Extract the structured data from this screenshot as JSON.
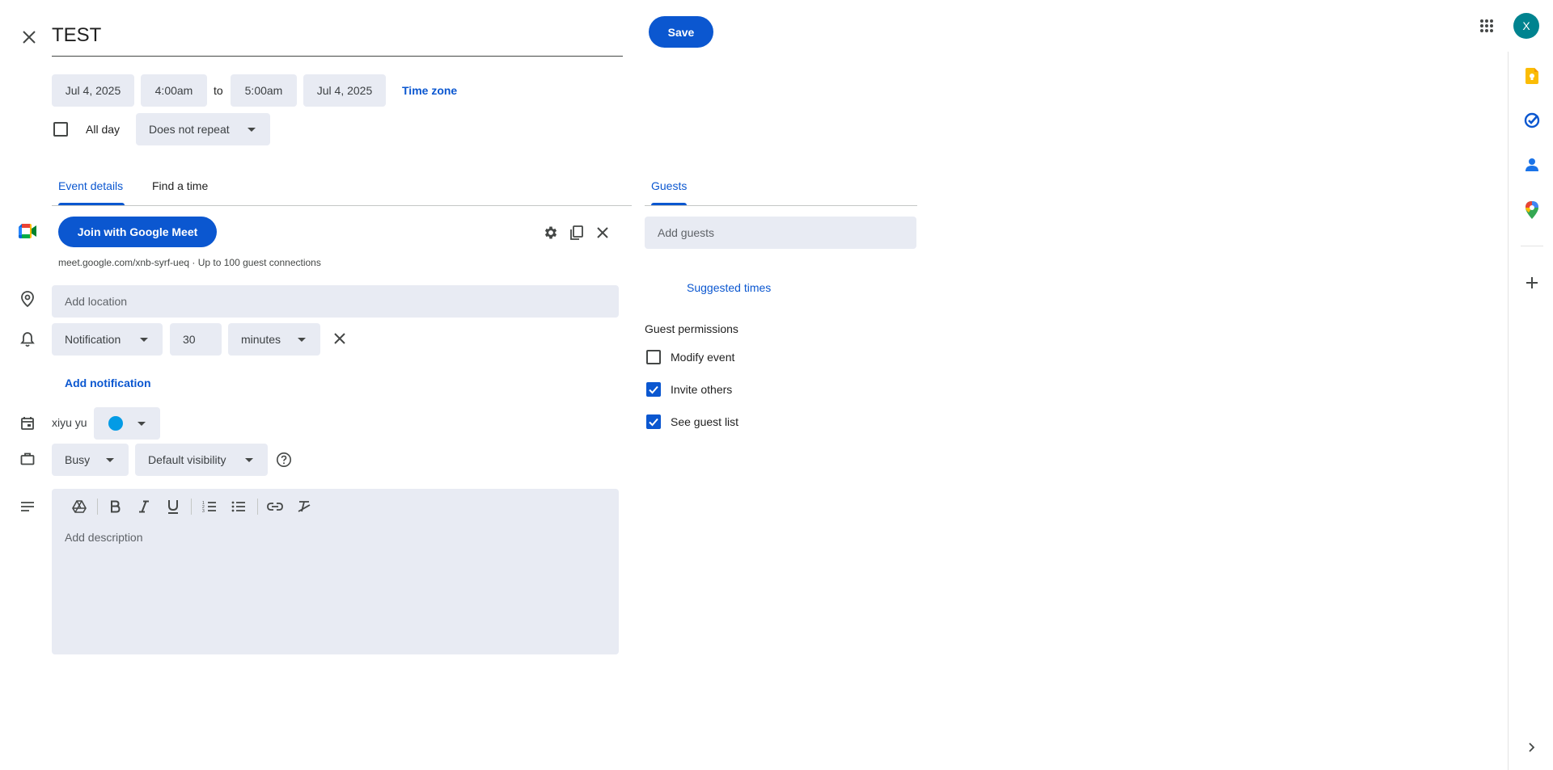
{
  "header": {
    "title_value": "TEST",
    "save_label": "Save",
    "avatar_letter": "X"
  },
  "datetime": {
    "start_date": "Jul 4, 2025",
    "start_time": "4:00am",
    "to_label": "to",
    "end_time": "5:00am",
    "end_date": "Jul 4, 2025",
    "time_zone_label": "Time zone",
    "all_day_label": "All day",
    "repeat_value": "Does not repeat"
  },
  "tabs": {
    "event_details": "Event details",
    "find_a_time": "Find a time",
    "guests": "Guests"
  },
  "meet": {
    "join_label": "Join with Google Meet",
    "info": "meet.google.com/xnb-syrf-ueq · Up to 100 guest connections"
  },
  "location": {
    "placeholder": "Add location"
  },
  "notification": {
    "type": "Notification",
    "amount": "30",
    "unit": "minutes",
    "add_label": "Add notification"
  },
  "calendar": {
    "owner": "xiyu yu",
    "color": "#039be5"
  },
  "availability": {
    "status": "Busy",
    "visibility": "Default visibility"
  },
  "description": {
    "placeholder": "Add description"
  },
  "guests": {
    "placeholder": "Add guests",
    "suggested_times": "Suggested times",
    "permissions_title": "Guest permissions",
    "permissions": [
      {
        "label": "Modify event",
        "checked": false
      },
      {
        "label": "Invite others",
        "checked": true
      },
      {
        "label": "See guest list",
        "checked": true
      }
    ]
  },
  "colors": {
    "accent": "#0b57d0",
    "field_bg": "#e8ebf3",
    "avatar_bg": "#00838f"
  }
}
